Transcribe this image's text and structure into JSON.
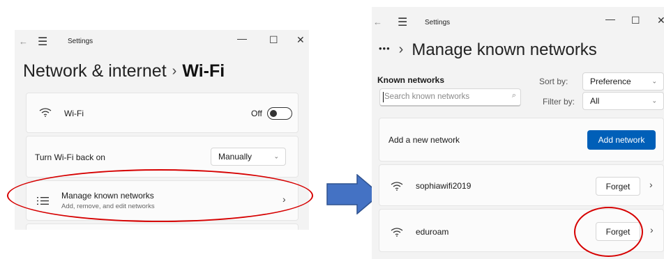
{
  "left_window": {
    "title": "Settings",
    "back_glyph": "←",
    "menu_glyph": "☰",
    "minimize_glyph": "—",
    "maximize_glyph": "☐",
    "close_glyph": "✕",
    "breadcrumb_parent": "Network & internet",
    "breadcrumb_separator": "›",
    "breadcrumb_current": "Wi-Fi",
    "wifi_label": "Wi-Fi",
    "wifi_state": "Off",
    "turn_back_on_label": "Turn Wi-Fi back on",
    "turn_back_on_value": "Manually",
    "dropdown_chevron": "⌄",
    "manage_label": "Manage known networks",
    "manage_sub": "Add, remove, and edit networks",
    "manage_chevron": "›",
    "wifi_icon": "wifi-icon",
    "list_icon": "list-icon"
  },
  "right_window": {
    "title": "Settings",
    "back_glyph": "←",
    "menu_glyph": "☰",
    "minimize_glyph": "—",
    "maximize_glyph": "☐",
    "close_glyph": "✕",
    "breadcrumb_ellipsis": "•••",
    "breadcrumb_separator": "›",
    "breadcrumb_current": "Manage known networks",
    "known_networks_heading": "Known networks",
    "search_placeholder": "Search known networks",
    "search_icon_glyph": "⌕",
    "sort_label": "Sort by:",
    "sort_value": "Preference",
    "filter_label": "Filter by:",
    "filter_value": "All",
    "dropdown_chevron": "⌄",
    "add_network_label": "Add a new network",
    "add_network_button": "Add network",
    "networks": [
      {
        "name": "sophiawifi2019",
        "forget": "Forget",
        "chevron": "›"
      },
      {
        "name": "eduroam",
        "forget": "Forget",
        "chevron": "›"
      }
    ]
  },
  "colors": {
    "accent": "#005fb8",
    "annotation": "#d60000",
    "arrow": "#4472c4",
    "window_bg": "#f3f3f3"
  }
}
